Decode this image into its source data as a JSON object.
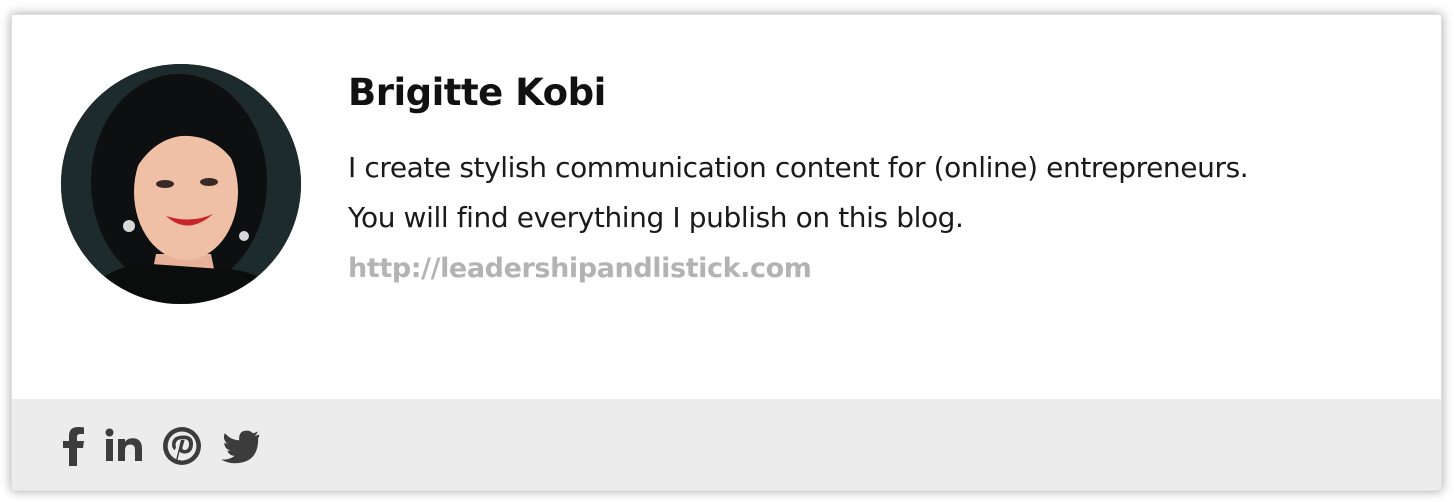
{
  "author": {
    "name": "Brigitte Kobi",
    "bio_lines": [
      "I create stylish communication content for (online) entrepreneurs.",
      "You will find everything I publish on this blog."
    ],
    "website": "http://leadershipandlistick.com"
  },
  "social": [
    {
      "network": "facebook",
      "icon": "facebook-icon"
    },
    {
      "network": "linkedin",
      "icon": "linkedin-icon"
    },
    {
      "network": "pinterest",
      "icon": "pinterest-icon"
    },
    {
      "network": "twitter",
      "icon": "twitter-icon"
    }
  ],
  "colors": {
    "name": "#111111",
    "bio": "#1a1a1a",
    "link": "#b3b3b3",
    "social_bar": "#ececec",
    "icons": "#3c3c3c"
  }
}
